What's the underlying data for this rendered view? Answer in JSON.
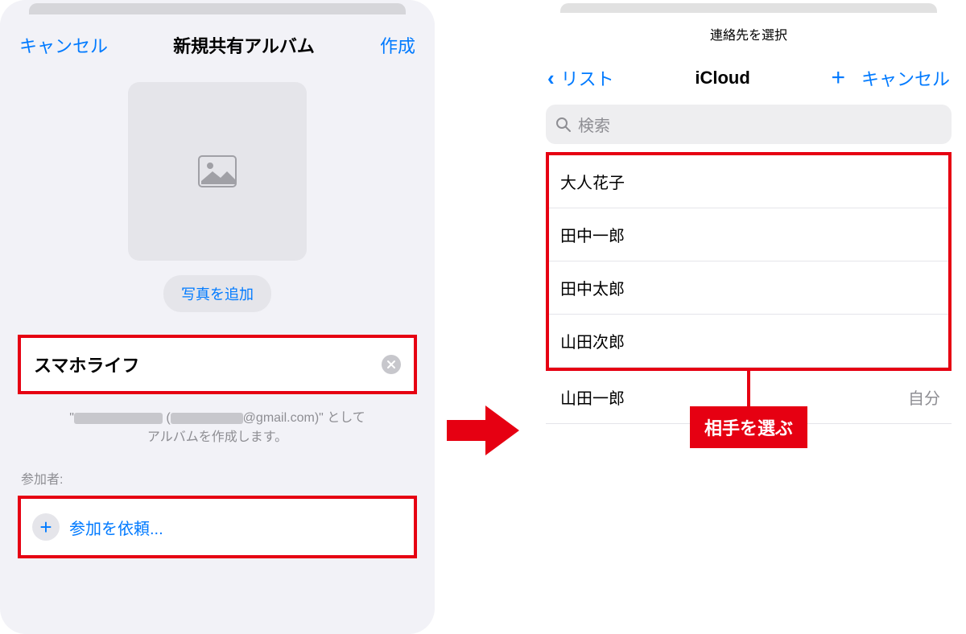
{
  "left": {
    "nav": {
      "cancel": "キャンセル",
      "title": "新規共有アルバム",
      "create": "作成"
    },
    "add_photo": "写真を追加",
    "album_name": "スマホライフ",
    "creator_prefix": "\"",
    "creator_email_suffix": "@gmail.com)\" として",
    "creator_line2": "アルバムを作成します。",
    "participants_label": "参加者:",
    "invite": "参加を依頼..."
  },
  "right": {
    "mini_title": "連絡先を選択",
    "nav": {
      "back": "リスト",
      "title": "iCloud",
      "cancel": "キャンセル"
    },
    "search_placeholder": "検索",
    "contacts": [
      "大人花子",
      "田中一郎",
      "田中太郎",
      "山田次郎"
    ],
    "self_contact": "山田一郎",
    "self_label": "自分"
  },
  "callout": "相手を選ぶ"
}
